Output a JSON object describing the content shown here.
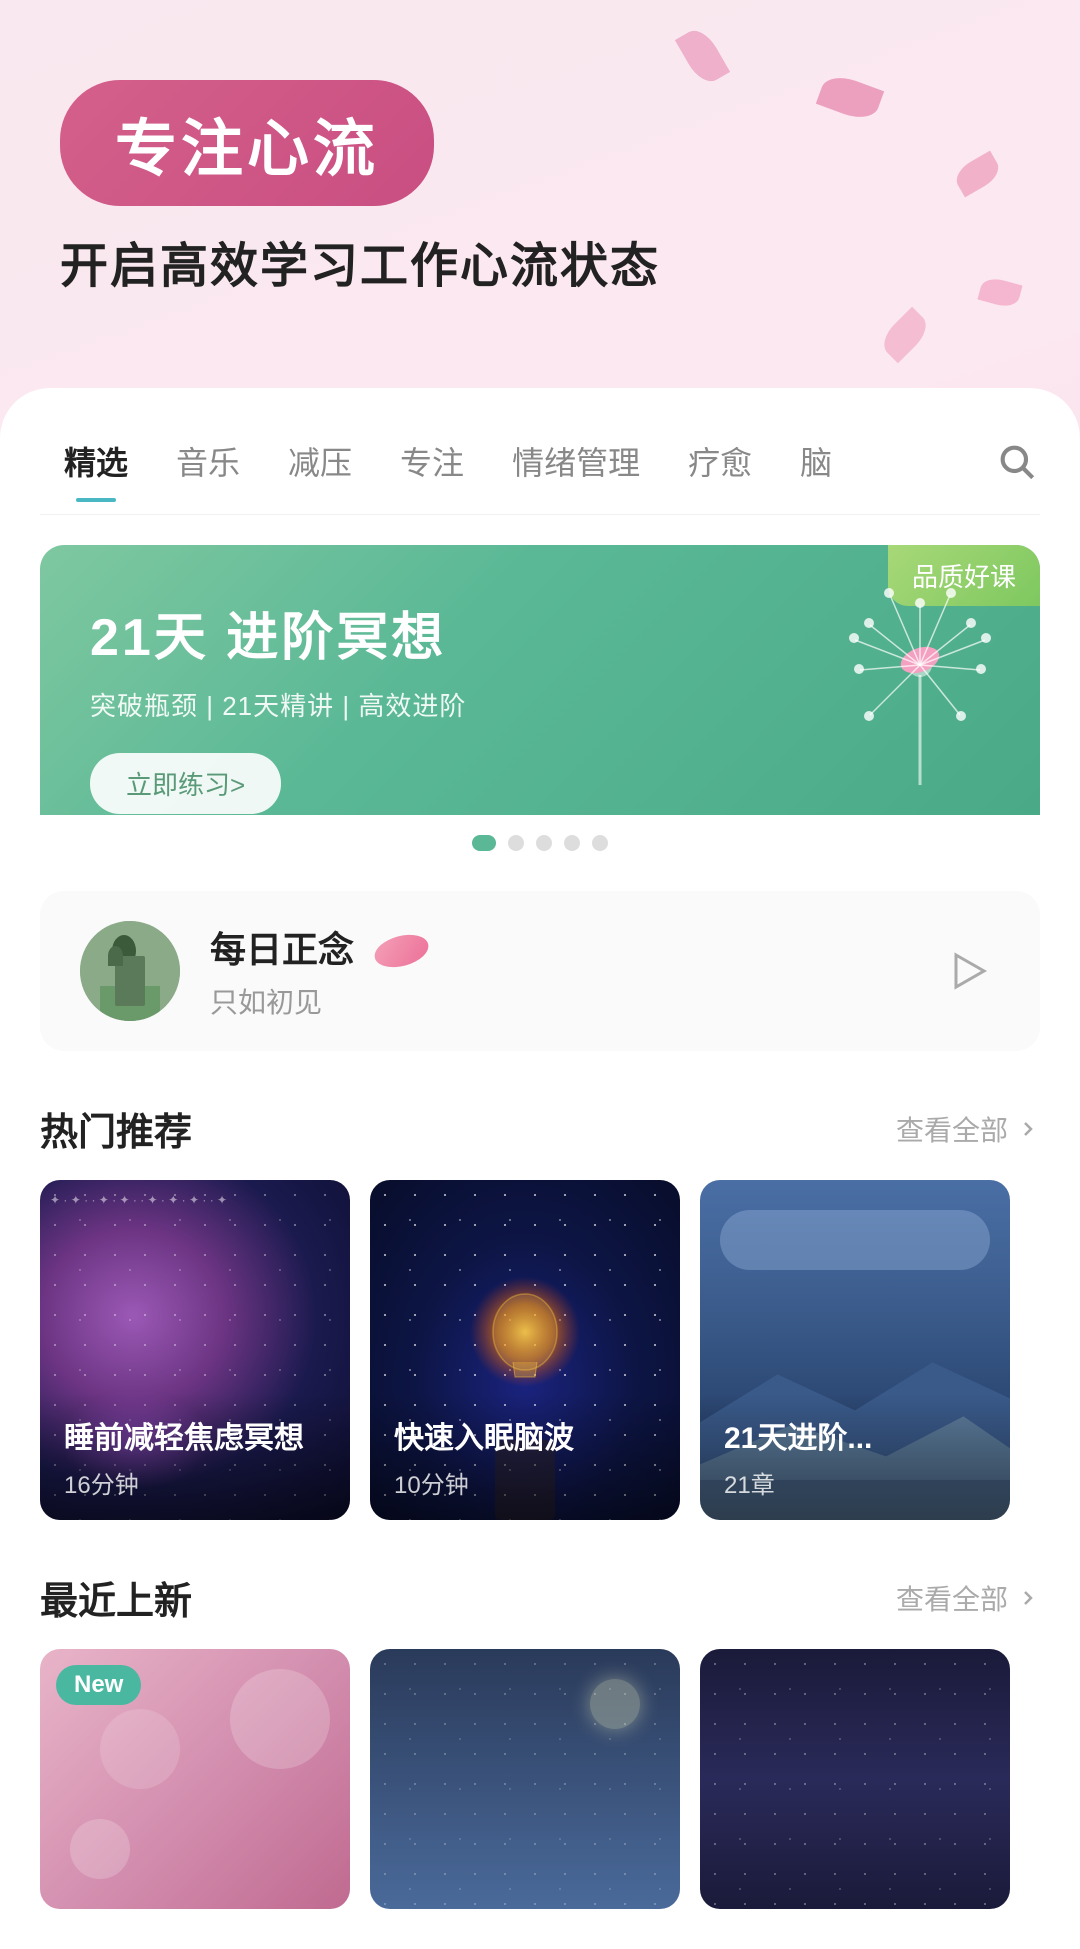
{
  "header": {
    "badge_text": "专注心流",
    "subtitle": "开启高效学习工作心流状态"
  },
  "tabs": {
    "items": [
      {
        "label": "精选",
        "active": true
      },
      {
        "label": "音乐",
        "active": false
      },
      {
        "label": "减压",
        "active": false
      },
      {
        "label": "专注",
        "active": false
      },
      {
        "label": "情绪管理",
        "active": false
      },
      {
        "label": "疗愈",
        "active": false
      },
      {
        "label": "脑...",
        "active": false
      }
    ]
  },
  "banner": {
    "quality_badge": "品质好课",
    "title": "21天 进阶冥想",
    "description": "突破瓶颈 | 21天精讲 | 高效进阶",
    "cta": "立即练习>",
    "dots": 5,
    "active_dot": 0
  },
  "daily": {
    "title": "每日正念",
    "subtitle": "只如初见",
    "play_label": "play"
  },
  "hot_section": {
    "title": "热门推荐",
    "more_label": "查看全部",
    "cards": [
      {
        "title": "睡前减轻焦虑冥想",
        "meta": "16分钟",
        "bg_type": "galaxy"
      },
      {
        "title": "快速入眠脑波",
        "meta": "10分钟",
        "bg_type": "lightbulb"
      },
      {
        "title": "21天进阶...",
        "meta": "21章",
        "bg_type": "mountain"
      }
    ]
  },
  "new_section": {
    "title": "最近上新",
    "more_label": "查看全部",
    "cards": [
      {
        "badge": "New",
        "bg_type": "pink"
      },
      {
        "badge": "",
        "bg_type": "night-blue"
      },
      {
        "badge": "",
        "bg_type": "dark"
      }
    ]
  }
}
